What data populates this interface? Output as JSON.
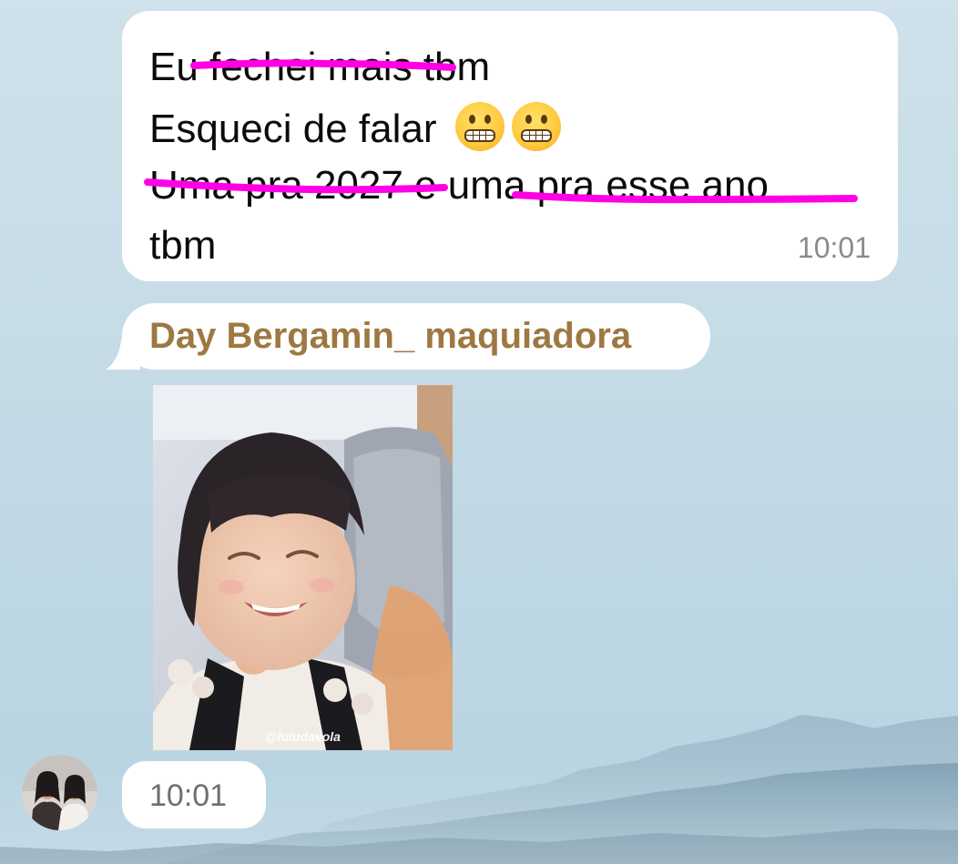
{
  "chat": {
    "messages": [
      {
        "lines": [
          "Eu fechei mais tbm",
          "Esqueci de falar",
          "Uma pra 2027 e uma pra esse ano",
          "tbm"
        ],
        "emojis": [
          "grimacing-face",
          "grimacing-face"
        ],
        "time": "10:01"
      },
      {
        "sender": "Day Bergamin_ maquiadora",
        "media_watermark": "@luludavola",
        "time": "10:01"
      }
    ]
  },
  "colors": {
    "bubble": "#ffffff",
    "sender_name": "#9d7842",
    "highlight": "#ff00e6",
    "timestamp": "#8a8a8e"
  }
}
